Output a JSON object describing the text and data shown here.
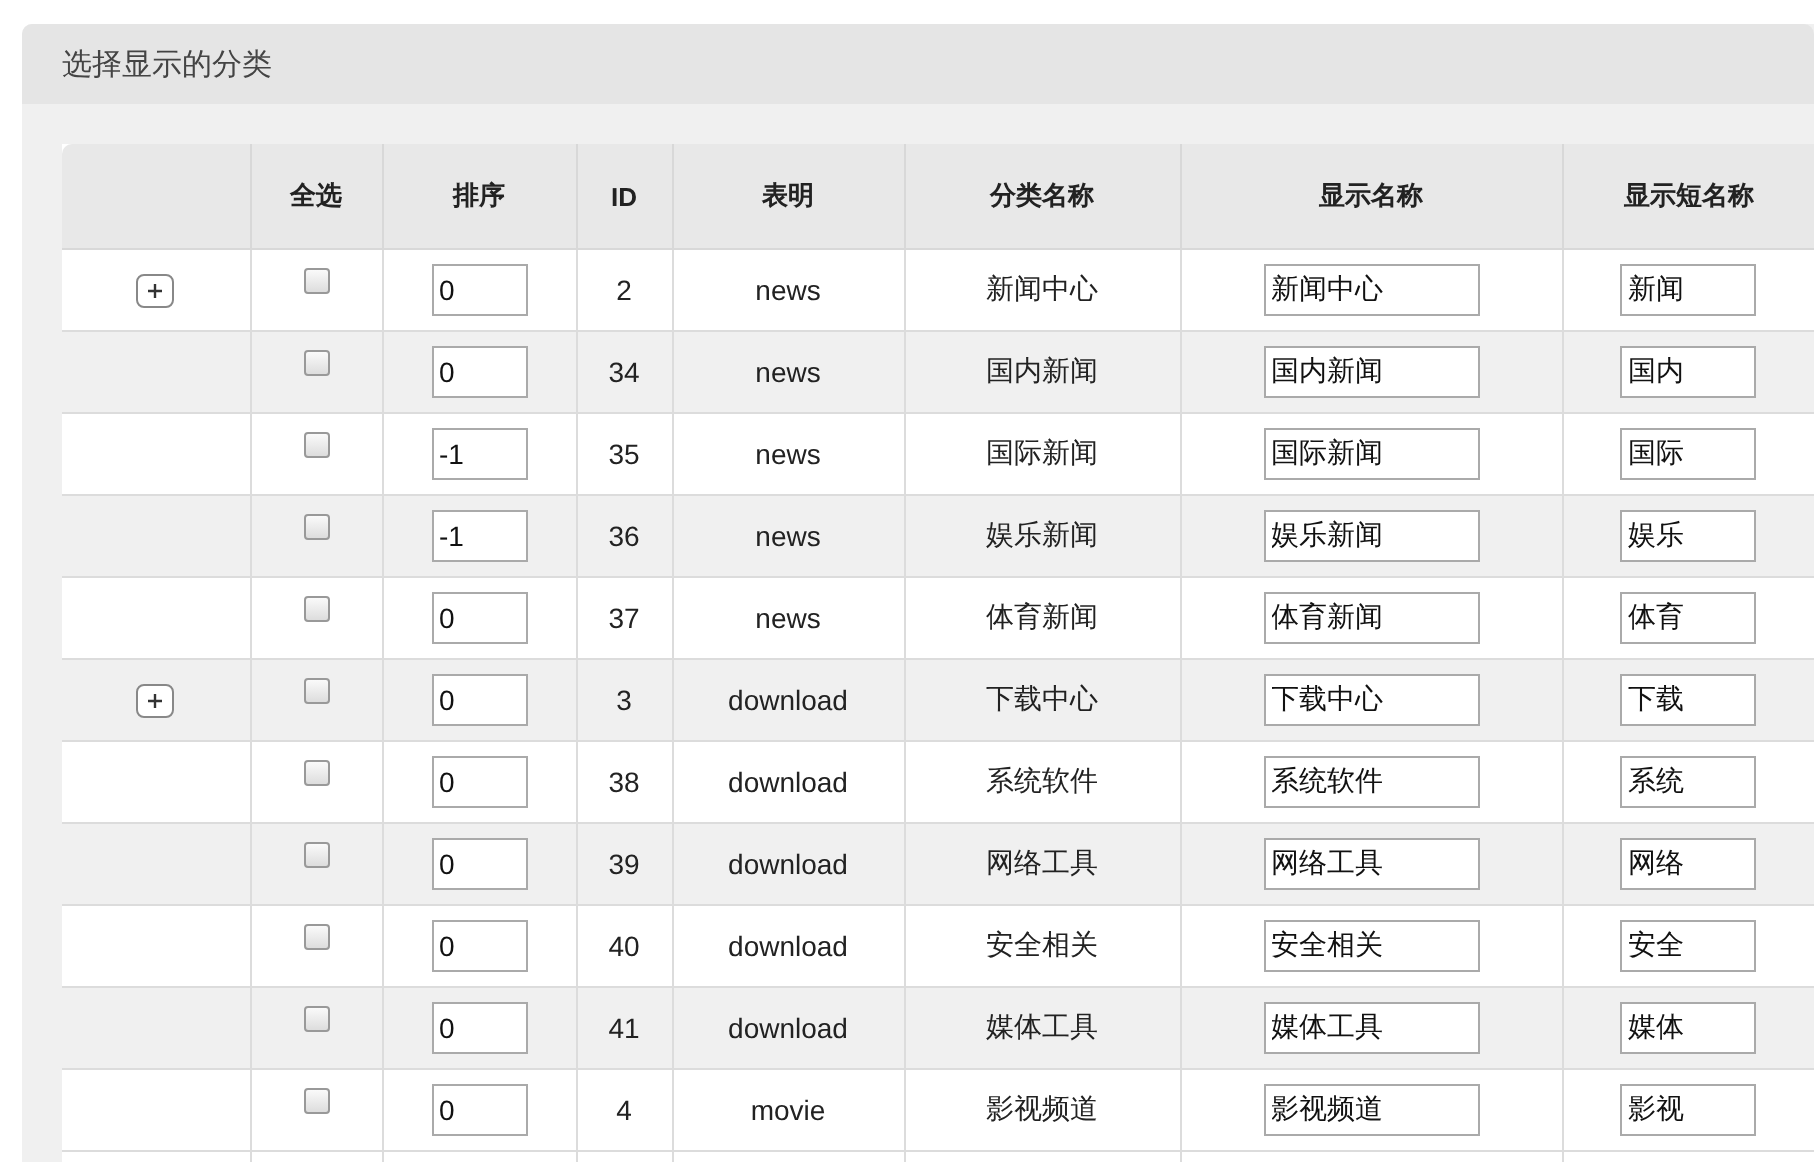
{
  "panel": {
    "title": "选择显示的分类"
  },
  "table": {
    "columns": [
      "全选",
      "排序",
      "ID",
      "表明",
      "分类名称",
      "显示名称",
      "显示短名称"
    ],
    "rows": [
      {
        "checked": false,
        "order": "0",
        "id": "2",
        "table": "news",
        "name": "新闻中心",
        "display_name": "新闻中心",
        "short_name": "新闻",
        "children": [
          {
            "checked": false,
            "order": "0",
            "id": "34",
            "table": "news",
            "name": "国内新闻",
            "display_name": "国内新闻",
            "short_name": "国内"
          },
          {
            "checked": false,
            "order": "-1",
            "id": "35",
            "table": "news",
            "name": "国际新闻",
            "display_name": "国际新闻",
            "short_name": "国际"
          },
          {
            "checked": false,
            "order": "-1",
            "id": "36",
            "table": "news",
            "name": "娱乐新闻",
            "display_name": "娱乐新闻",
            "short_name": "娱乐"
          },
          {
            "checked": false,
            "order": "0",
            "id": "37",
            "table": "news",
            "name": "体育新闻",
            "display_name": "体育新闻",
            "short_name": "体育"
          }
        ]
      },
      {
        "checked": false,
        "order": "0",
        "id": "3",
        "table": "download",
        "name": "下载中心",
        "display_name": "下载中心",
        "short_name": "下载",
        "children": [
          {
            "checked": false,
            "order": "0",
            "id": "38",
            "table": "download",
            "name": "系统软件",
            "display_name": "系统软件",
            "short_name": "系统"
          },
          {
            "checked": false,
            "order": "0",
            "id": "39",
            "table": "download",
            "name": "网络工具",
            "display_name": "网络工具",
            "short_name": "网络"
          },
          {
            "checked": false,
            "order": "0",
            "id": "40",
            "table": "download",
            "name": "安全相关",
            "display_name": "安全相关",
            "short_name": "安全"
          },
          {
            "checked": false,
            "order": "0",
            "id": "41",
            "table": "download",
            "name": "媒体工具",
            "display_name": "媒体工具",
            "short_name": "媒体"
          }
        ]
      },
      {
        "checked": false,
        "order": "0",
        "id": "4",
        "table": "movie",
        "name": "影视频道",
        "display_name": "影视频道",
        "short_name": "影视"
      }
    ]
  }
}
